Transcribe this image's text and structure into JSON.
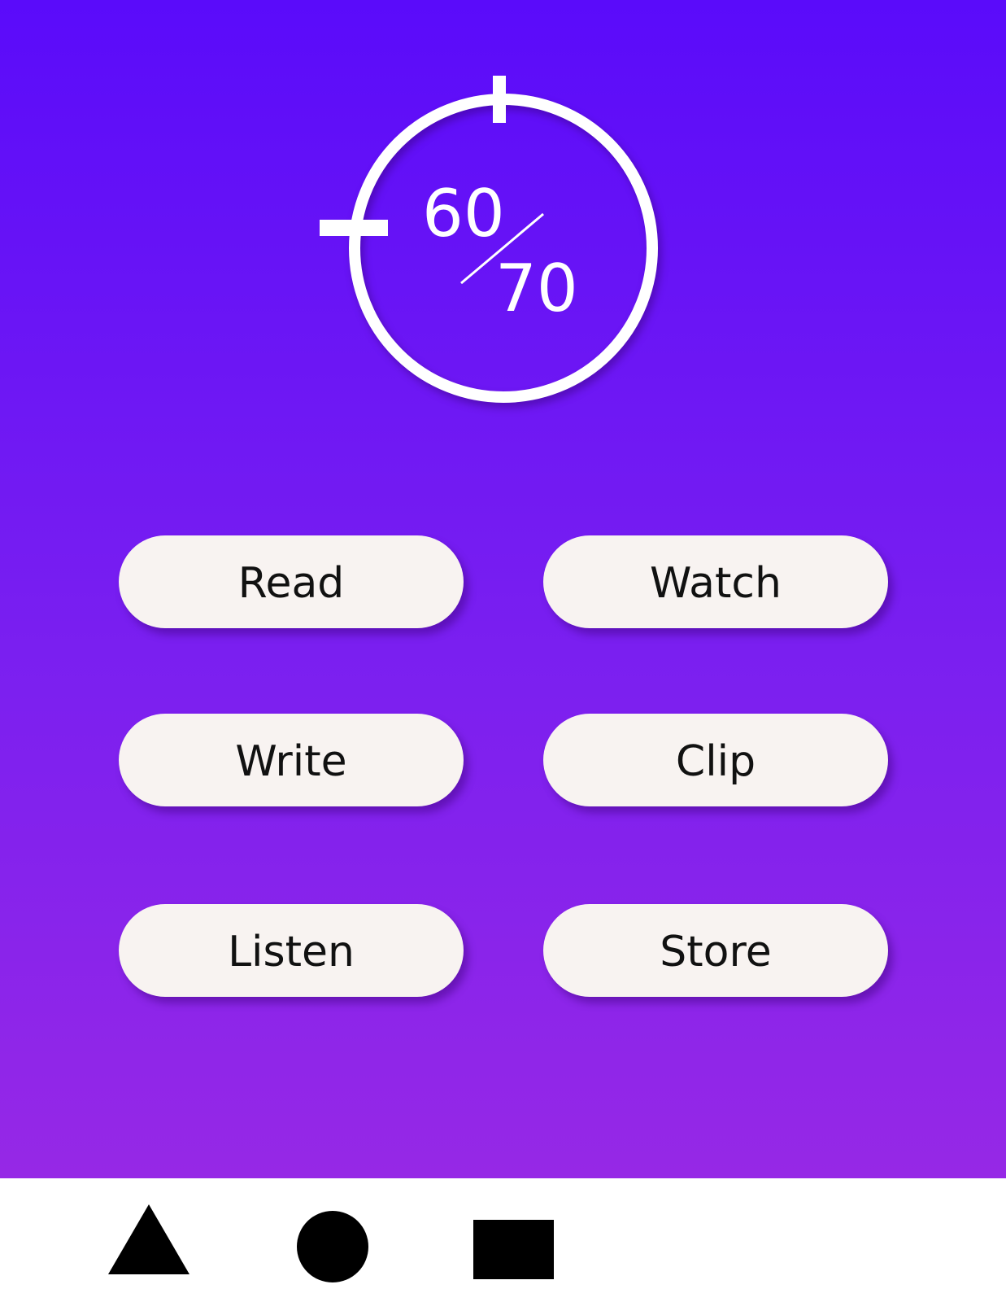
{
  "progress": {
    "current": "60",
    "total": "70",
    "fraction": 0.857
  },
  "actions": [
    {
      "label": "Read"
    },
    {
      "label": "Watch"
    },
    {
      "label": "Write"
    },
    {
      "label": "Clip"
    },
    {
      "label": "Listen"
    },
    {
      "label": "Store"
    }
  ],
  "nav": [
    {
      "icon": "triangle-icon"
    },
    {
      "icon": "circle-icon"
    },
    {
      "icon": "square-icon"
    }
  ],
  "colors": {
    "gradient_top": "#5a0bfa",
    "gradient_bottom": "#9628e6",
    "button_bg": "#f8f3f1",
    "ring": "#ffffff"
  }
}
